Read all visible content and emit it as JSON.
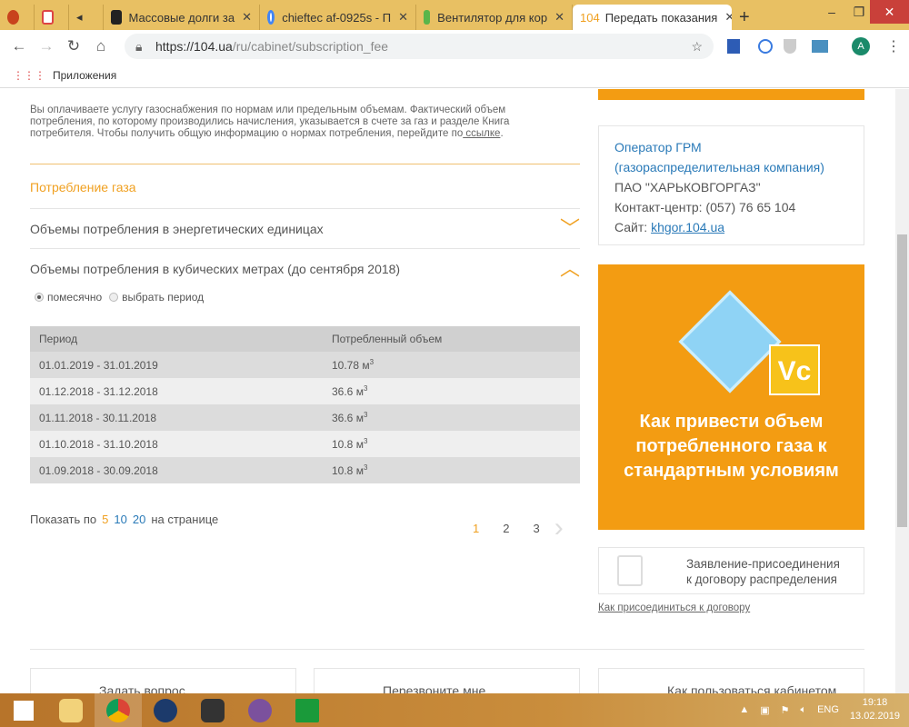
{
  "browser": {
    "tabs": [
      {
        "label": "",
        "icon": "star-badge-icon"
      },
      {
        "label": "",
        "icon": "gmail-icon"
      },
      {
        "label": "",
        "icon": "speaker-icon"
      },
      {
        "label": "Массовые долги за",
        "icon": "site-icon"
      },
      {
        "label": "chieftec af-0925s - П",
        "icon": "google-icon"
      },
      {
        "label": "Вентилятор для кор",
        "icon": "site-icon"
      },
      {
        "label": "Передать показания",
        "icon": "104-icon",
        "badge": "104",
        "active": true
      }
    ],
    "url_host": "https://104.ua",
    "url_path": "/ru/cabinet/subscription_fee",
    "bookmarks_apps": "Приложения",
    "profile_initial": "A"
  },
  "main": {
    "intro": "Вы оплачиваете услугу газоснабжения по нормам или предельным объемам. Фактический объем потребления, по которому производились начисления, указывается в счете за газ и разделе Книга потребителя. Чтобы получить общую информацию о нормах потребления, перейдите по",
    "intro_link": " ссылке",
    "section_title": "Потребление газа",
    "accordion": [
      {
        "label": "Объемы потребления в энергетических единицах",
        "expanded": false
      },
      {
        "label": "Объемы потребления в кубических метрах (до сентября 2018)",
        "expanded": true
      }
    ],
    "radio": [
      {
        "label": "помесячно",
        "checked": true
      },
      {
        "label": "выбрать период",
        "checked": false
      }
    ],
    "table": {
      "headers": [
        "Период",
        "Потребленный объем"
      ],
      "unit": "м",
      "unit_sup": "3",
      "rows": [
        [
          "01.01.2019 - 31.01.2019",
          "10.78"
        ],
        [
          "01.12.2018 - 31.12.2018",
          "36.6"
        ],
        [
          "01.11.2018 - 30.11.2018",
          "36.6"
        ],
        [
          "01.10.2018 - 31.10.2018",
          "10.8"
        ],
        [
          "01.09.2018 - 30.09.2018",
          "10.8"
        ]
      ]
    },
    "pager": {
      "show": "Показать по",
      "sizes": [
        "5",
        "10",
        "20"
      ],
      "per_page": "на странице",
      "pages": [
        "1",
        "2",
        "3"
      ],
      "current": "1"
    }
  },
  "sidebar": {
    "operator_title": "Оператор ГРМ",
    "operator_sub": "(газораспределительная компания)",
    "company": "ПАО \"ХАРЬКОВГОРГАЗ\"",
    "contact": "Контакт-центр: (057) 76 65 104",
    "site_label": "Сайт:",
    "site_link": "khgor.104.ua",
    "promo_badge": "Vc",
    "promo_text": "Как привести объем потребленного газа к стандартным условиям",
    "doc_line1": "Заявление-присоединения",
    "doc_line2": "к договору распределения",
    "join_link": "Как присоединиться к договору"
  },
  "bottom_cards": [
    "Задать вопрос",
    "Перезвоните мне",
    "Как пользоваться кабинетом"
  ],
  "taskbar": {
    "lang": "ENG",
    "time": "19:18",
    "date": "13.02.2019"
  },
  "colors": {
    "accent": "#f39c12",
    "link": "#2a7ab8",
    "tabbar": "#e8c063"
  }
}
